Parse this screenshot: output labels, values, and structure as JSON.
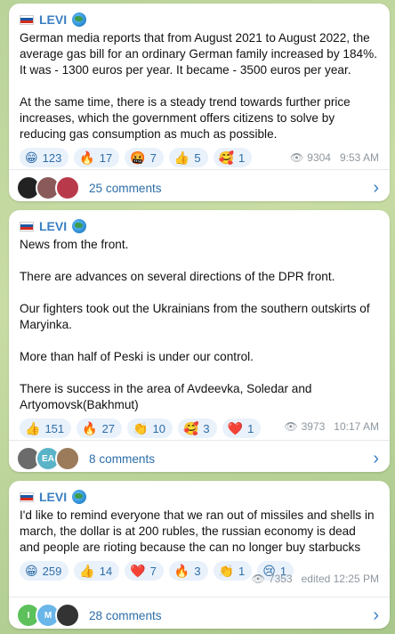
{
  "posts": [
    {
      "author": "LEVI",
      "text": "German media reports that from August 2021 to August 2022, the average gas bill for an ordinary German family increased by 184%.\nIt was - 1300 euros per year. It became - 3500 euros per year.\n\nAt the same time, there is a steady trend towards further price increases, which the government offers citizens to solve by reducing gas consumption as much as possible.",
      "reactions": [
        {
          "emoji": "😁",
          "count": "123"
        },
        {
          "emoji": "🔥",
          "count": "17"
        },
        {
          "emoji": "🤬",
          "count": "7"
        },
        {
          "emoji": "👍",
          "count": "5"
        },
        {
          "emoji": "🥰",
          "count": "1"
        }
      ],
      "views": "9304",
      "time": "9:53 AM",
      "comments": "25 comments",
      "avatar_colors": [
        "#222222",
        "#8a5a5a",
        "#b83a4a"
      ],
      "avatar_letters": [
        "",
        "",
        ""
      ]
    },
    {
      "author": "LEVI",
      "text": "News from the front.\n\nThere are advances on several directions of the DPR front.\n\nOur fighters took out the Ukrainians from the southern outskirts of Maryinka.\n\nMore than half of Peski is under our control.\n\nThere is success in the area of  Avdeevka, Soledar and Artyomovsk(Bakhmut)",
      "reactions": [
        {
          "emoji": "👍",
          "count": "151"
        },
        {
          "emoji": "🔥",
          "count": "27"
        },
        {
          "emoji": "👏",
          "count": "10"
        },
        {
          "emoji": "🥰",
          "count": "3"
        },
        {
          "emoji": "❤️",
          "count": "1"
        }
      ],
      "views": "3973",
      "time": "10:17 AM",
      "comments": "8 comments",
      "avatar_colors": [
        "#6b6b6b",
        "#5ab4c8",
        "#9b7b5a"
      ],
      "avatar_letters": [
        "",
        "EA",
        ""
      ]
    },
    {
      "author": "LEVI",
      "text": "I'd like to remind everyone that we ran out of missiles and shells in march, the dollar is at 200 rubles, the russian economy is dead and people are rioting because the can no longer buy starbucks",
      "reactions": [
        {
          "emoji": "😁",
          "count": "259"
        },
        {
          "emoji": "👍",
          "count": "14"
        },
        {
          "emoji": "❤️",
          "count": "7"
        },
        {
          "emoji": "🔥",
          "count": "3"
        },
        {
          "emoji": "👏",
          "count": "1"
        },
        {
          "emoji": "😢",
          "count": "1"
        }
      ],
      "views": "7353",
      "time": "edited 12:25 PM",
      "comments": "28 comments",
      "avatar_colors": [
        "#5cc15a",
        "#6ab6e8",
        "#333333"
      ],
      "avatar_letters": [
        "I",
        "M",
        ""
      ]
    }
  ],
  "colors": {
    "accent": "#3a7fc2",
    "chip_bg": "#e9f1fb",
    "meta": "#8e979f",
    "background": "#b9d39a"
  },
  "icons": {
    "flag": "russia-flag-icon",
    "globe": "globe-icon",
    "views": "eye-icon",
    "chevron": "chevron-right-icon"
  }
}
